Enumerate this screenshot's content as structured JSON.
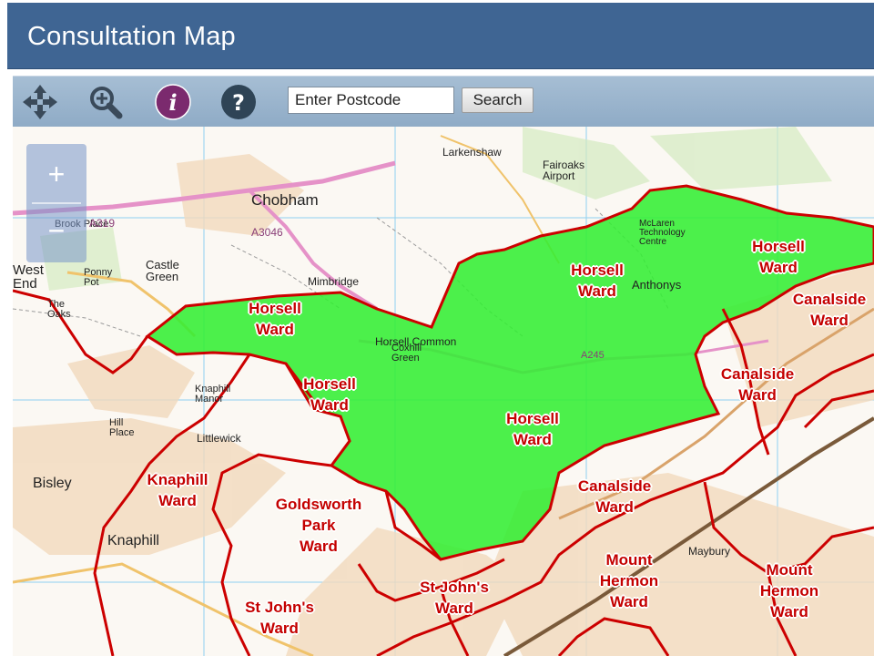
{
  "app": {
    "title": "Consultation Map"
  },
  "toolbar": {
    "tools": [
      {
        "name": "pan-tool",
        "icon": "move-arrows-icon"
      },
      {
        "name": "zoom-tool",
        "icon": "zoom-in-magnifier-icon"
      },
      {
        "name": "identify-tool",
        "icon": "info-icon"
      },
      {
        "name": "help-tool",
        "icon": "question-mark-icon"
      }
    ],
    "postcode_value": "Enter Postcode",
    "search_label": "Search"
  },
  "map": {
    "zoom_in_label": "+",
    "zoom_out_label": "−",
    "colors": {
      "highlight_fill": "#33ee33",
      "ward_boundary": "#cc0000",
      "ward_label": "#c40000",
      "toolbar": "#9bb5ce",
      "title_bar": "#3f6593"
    },
    "place_names": [
      "Chobham",
      "Larkenshaw",
      "Fairoaks Airport",
      "West End",
      "Castle Green",
      "Knaphill Manor",
      "Littlewick",
      "Bisley",
      "Knaphill",
      "Horsell Common",
      "Coxhill Green",
      "McLaren Technology Centre",
      "Anthonys",
      "Maybury",
      "Mimbridge",
      "Ponny Pot",
      "The Oaks",
      "Brook Place",
      "A319",
      "A3046",
      "A245",
      "Hill Place"
    ],
    "ward_labels": [
      {
        "id": "horsell-1",
        "lines": [
          "Horsell",
          "Ward"
        ]
      },
      {
        "id": "horsell-2",
        "lines": [
          "Horsell",
          "Ward"
        ]
      },
      {
        "id": "horsell-3",
        "lines": [
          "Horsell",
          "Ward"
        ]
      },
      {
        "id": "horsell-4",
        "lines": [
          "Horsell",
          "Ward"
        ]
      },
      {
        "id": "horsell-5",
        "lines": [
          "Horsell",
          "Ward"
        ]
      },
      {
        "id": "canalside-1",
        "lines": [
          "Canalside",
          "Ward"
        ]
      },
      {
        "id": "canalside-2",
        "lines": [
          "Canalside",
          "Ward"
        ]
      },
      {
        "id": "canalside-3",
        "lines": [
          "Canalside",
          "Ward"
        ]
      },
      {
        "id": "knaphill",
        "lines": [
          "Knaphill",
          "Ward"
        ]
      },
      {
        "id": "goldsworth-park",
        "lines": [
          "Goldsworth",
          "Park",
          "Ward"
        ]
      },
      {
        "id": "st-johns-1",
        "lines": [
          "St John's",
          "Ward"
        ]
      },
      {
        "id": "st-johns-2",
        "lines": [
          "St John's",
          "Ward"
        ]
      },
      {
        "id": "mount-hermon-1",
        "lines": [
          "Mount",
          "Hermon",
          "Ward"
        ]
      },
      {
        "id": "mount-hermon-2",
        "lines": [
          "Mount",
          "Hermon",
          "Ward"
        ]
      }
    ]
  }
}
